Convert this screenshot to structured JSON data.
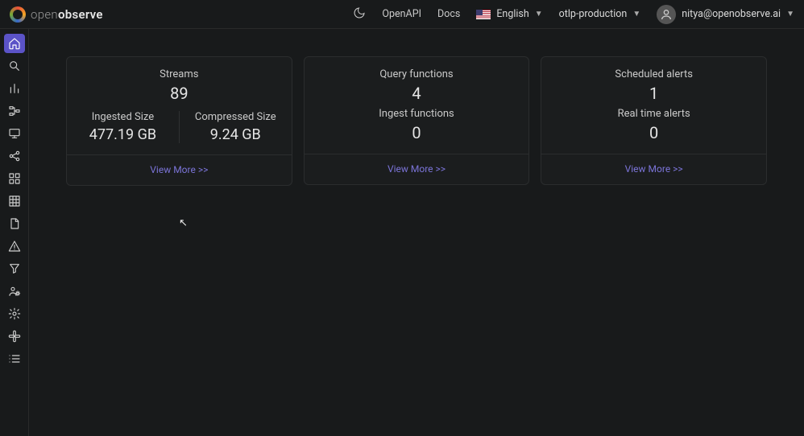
{
  "brand": {
    "thin": "open",
    "bold": "observe"
  },
  "topbar": {
    "openapi": "OpenAPI",
    "docs": "Docs",
    "language": "English",
    "org": "otlp-production",
    "user": "nitya@openobserve.ai"
  },
  "cards": {
    "streams": {
      "title": "Streams",
      "value": "89",
      "ingested_label": "Ingested Size",
      "ingested_value": "477.19 GB",
      "compressed_label": "Compressed Size",
      "compressed_value": "9.24 GB",
      "view_more": "View More >>"
    },
    "functions": {
      "title": "Query functions",
      "value": "4",
      "ingest_label": "Ingest functions",
      "ingest_value": "0",
      "view_more": "View More >>"
    },
    "alerts": {
      "title": "Scheduled alerts",
      "value": "1",
      "rt_label": "Real time alerts",
      "rt_value": "0",
      "view_more": "View More >>"
    }
  }
}
